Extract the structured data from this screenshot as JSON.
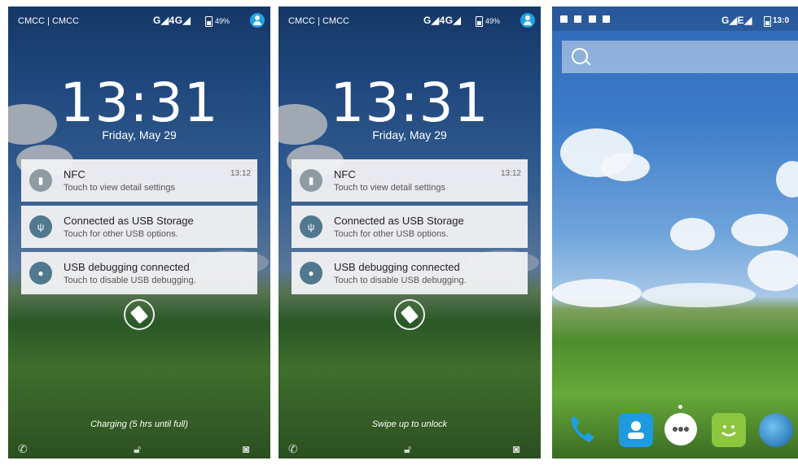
{
  "lock1": {
    "carrier": "CMCC | CMCC",
    "signal": "G◢4G◢",
    "battery": "49%",
    "time": "13:31",
    "date": "Friday, May 29",
    "notifications": [
      {
        "title": "NFC",
        "subtitle": "Touch to view detail settings",
        "time": "13:12"
      },
      {
        "title": "Connected as USB Storage",
        "subtitle": "Touch for other USB options.",
        "time": ""
      },
      {
        "title": "USB debugging connected",
        "subtitle": "Touch to disable USB debugging.",
        "time": ""
      }
    ],
    "bottom_text": "Charging (5 hrs until full)"
  },
  "lock2": {
    "carrier": "CMCC | CMCC",
    "signal": "G◢4G◢",
    "battery": "49%",
    "time": "13:31",
    "date": "Friday, May 29",
    "notifications": [
      {
        "title": "NFC",
        "subtitle": "Touch to view detail settings",
        "time": "13:12"
      },
      {
        "title": "Connected as USB Storage",
        "subtitle": "Touch for other USB options.",
        "time": ""
      },
      {
        "title": "USB debugging connected",
        "subtitle": "Touch to disable USB debugging.",
        "time": ""
      }
    ],
    "bottom_text": "Swipe up to unlock"
  },
  "home": {
    "signal": "G◢E◢",
    "time": "13:0"
  },
  "icons": {
    "phone": "phone-icon",
    "unlock": "lock-icon",
    "camera": "camera-icon",
    "search": "search-icon"
  },
  "colors": {
    "notif_icon": "#8f9ba3",
    "usb_icon": "#50788e",
    "accent": "#1ea4e6"
  }
}
